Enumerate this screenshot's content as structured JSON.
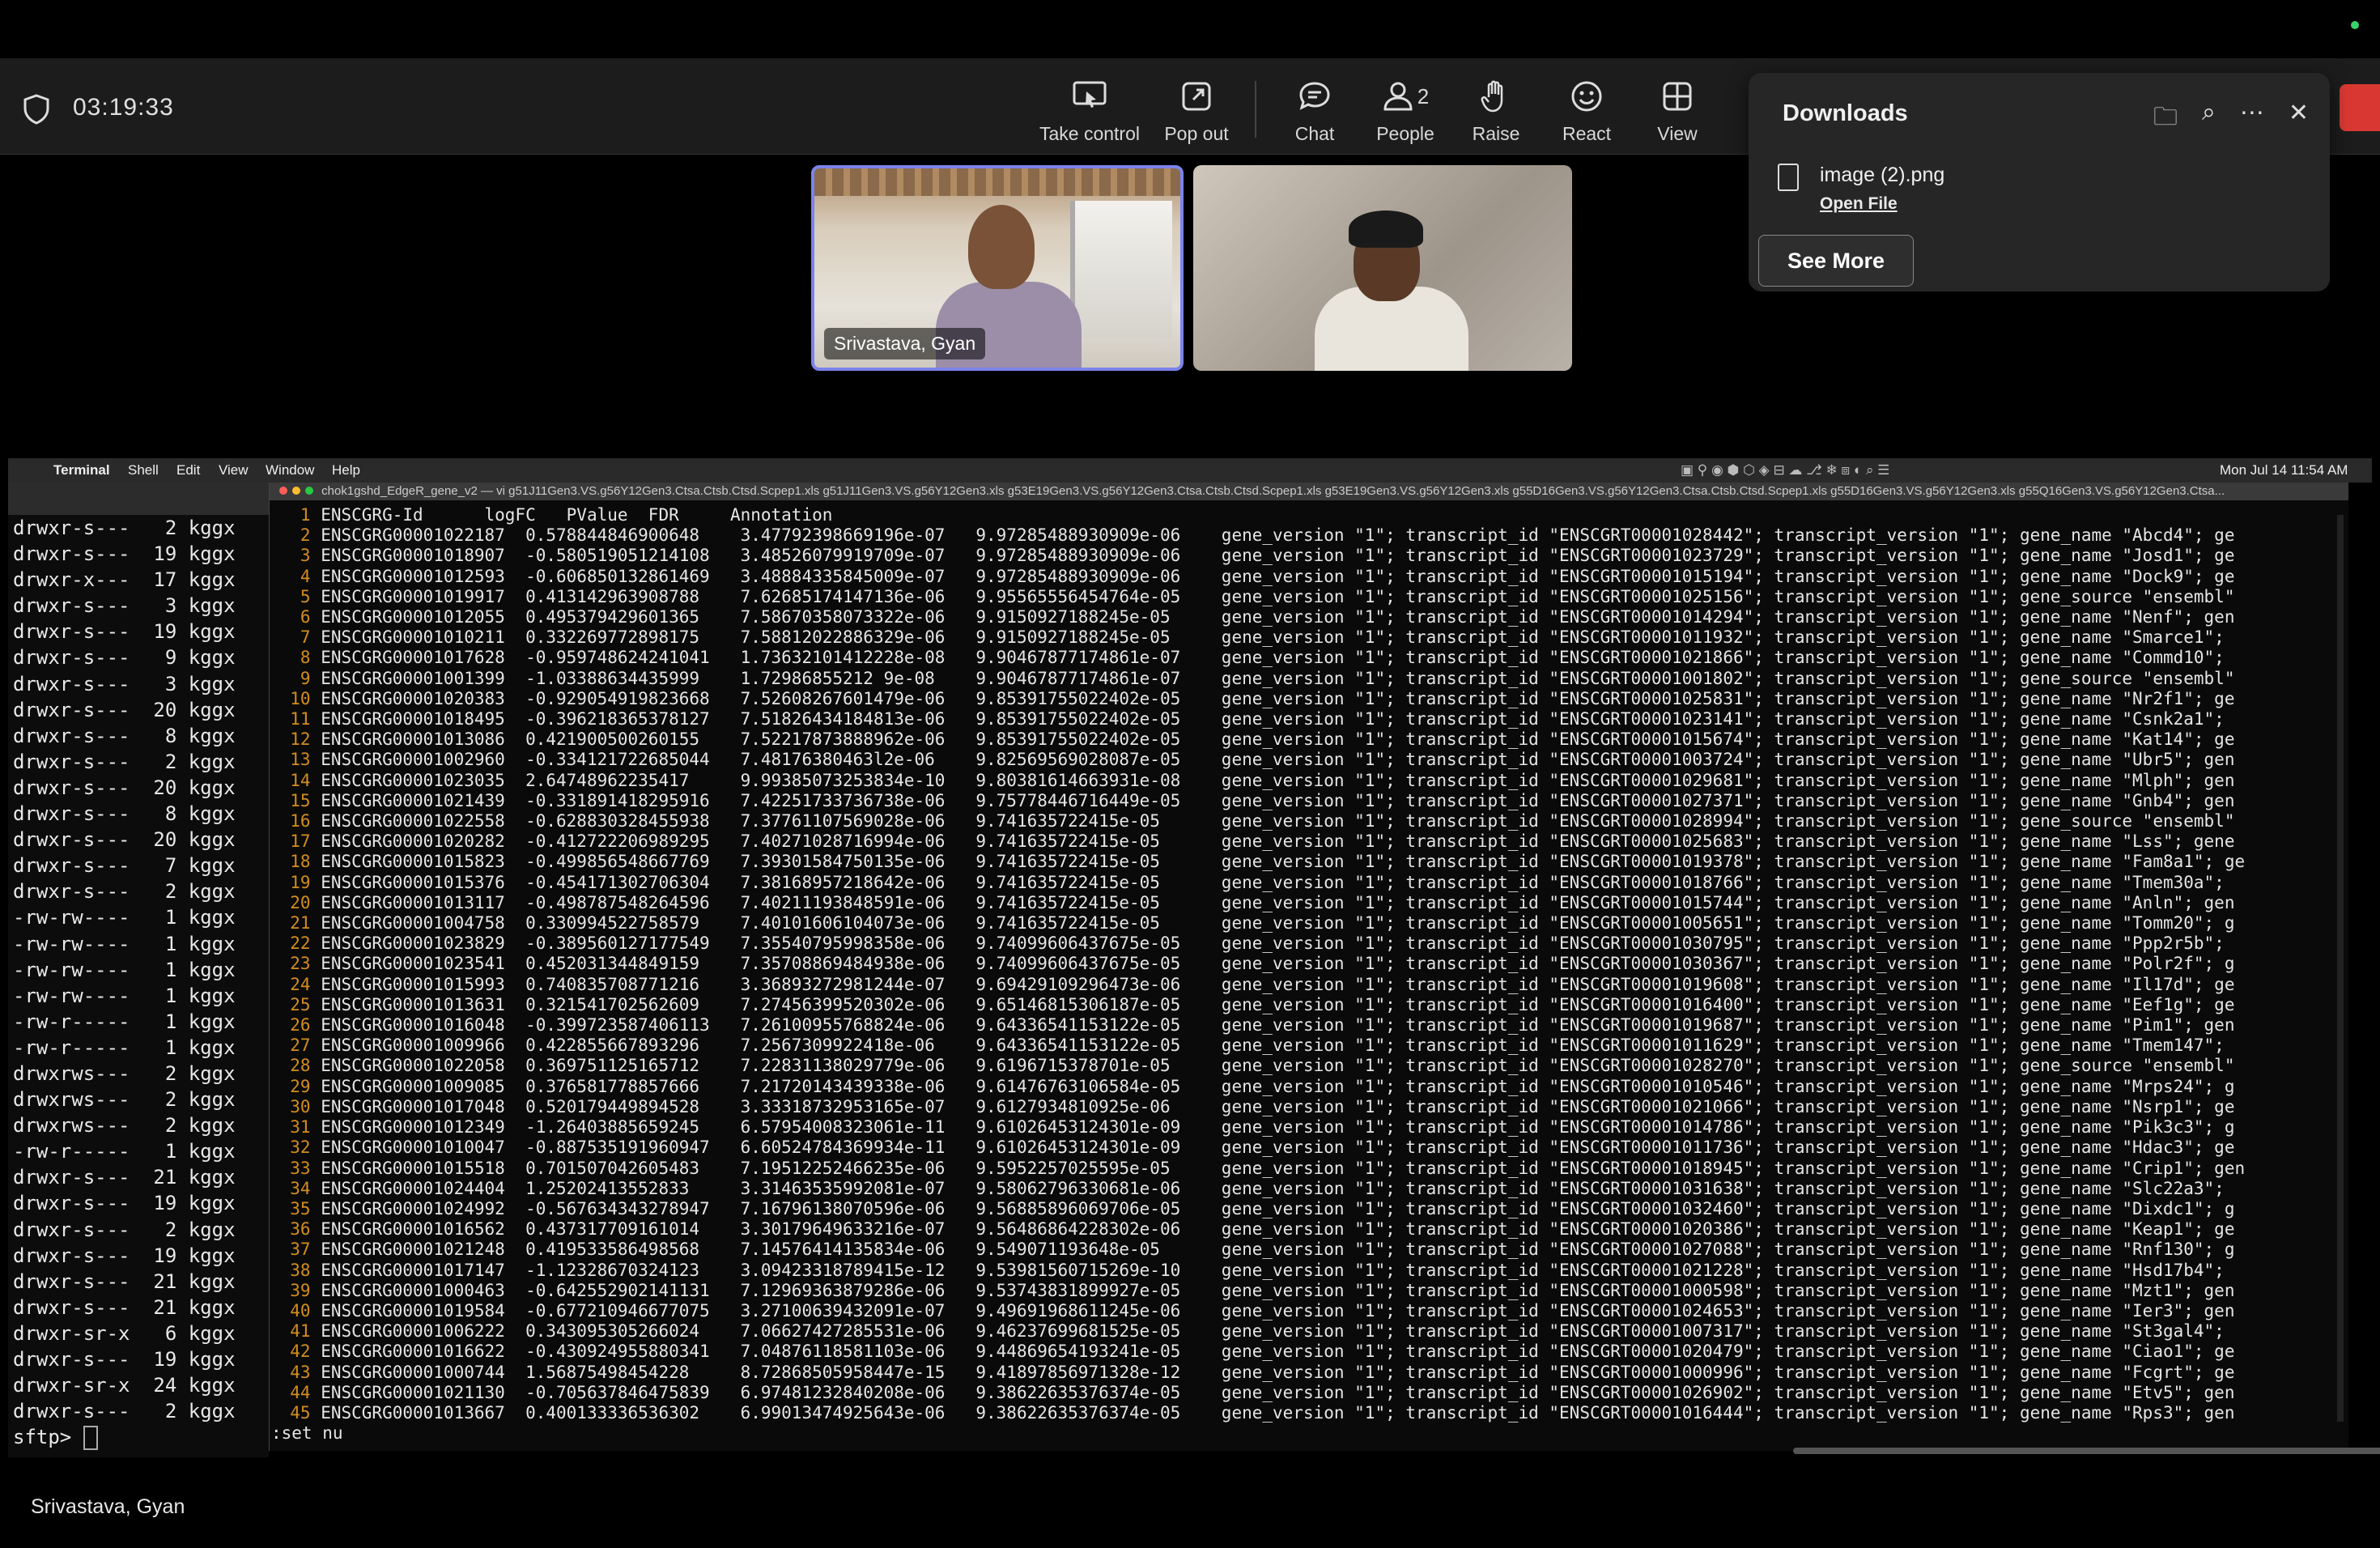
{
  "meeting": {
    "timer": "03:19:33",
    "toolbar": [
      {
        "label": "Take control",
        "icon": "take-control-icon"
      },
      {
        "label": "Pop out",
        "icon": "pop-out-icon"
      },
      {
        "label": "Chat",
        "icon": "chat-icon"
      },
      {
        "label": "People",
        "icon": "people-icon",
        "badge": "2"
      },
      {
        "label": "Raise",
        "icon": "raise-hand-icon"
      },
      {
        "label": "React",
        "icon": "react-icon"
      },
      {
        "label": "View",
        "icon": "view-icon"
      }
    ],
    "participants": [
      {
        "name": "Srivastava, Gyan"
      },
      {
        "name": ""
      }
    ],
    "presenter": "Srivastava, Gyan"
  },
  "downloads": {
    "title": "Downloads",
    "file_name": "image (2).png",
    "open_file": "Open File",
    "see_more": "See More"
  },
  "mac_menu": {
    "items": [
      "Terminal",
      "Shell",
      "Edit",
      "View",
      "Window",
      "Help"
    ],
    "clock": "Mon Jul 14  11:54 AM"
  },
  "left_terminal": {
    "lines": [
      "drwxr-s---   2 kggx",
      "drwxr-s---  19 kggx",
      "drwxr-x---  17 kggx",
      "drwxr-s---   3 kggx",
      "drwxr-s---  19 kggx",
      "drwxr-s---   9 kggx",
      "drwxr-s---   3 kggx",
      "drwxr-s---  20 kggx",
      "drwxr-s---   8 kggx",
      "drwxr-s---   2 kggx",
      "drwxr-s---  20 kggx",
      "drwxr-s---   8 kggx",
      "drwxr-s---  20 kggx",
      "drwxr-s---   7 kggx",
      "drwxr-s---   2 kggx",
      "-rw-rw----   1 kggx",
      "-rw-rw----   1 kggx",
      "-rw-rw----   1 kggx",
      "-rw-rw----   1 kggx",
      "-rw-r-----   1 kggx",
      "-rw-r-----   1 kggx",
      "drwxrws---   2 kggx",
      "drwxrws---   2 kggx",
      "drwxrws---   2 kggx",
      "-rw-r-----   1 kggx",
      "drwxr-s---  21 kggx",
      "drwxr-s---  19 kggx",
      "drwxr-s---   2 kggx",
      "drwxr-s---  19 kggx",
      "drwxr-s---  21 kggx",
      "drwxr-s---  21 kggx",
      "drwxr-sr-x   6 kggx",
      "drwxr-s---  19 kggx",
      "drwxr-sr-x  24 kggx",
      "drwxr-s---   2 kggx"
    ],
    "prompt": "sftp> "
  },
  "vim": {
    "title": "chok1gshd_EdgeR_gene_v2 — vi g51J11Gen3.VS.g56Y12Gen3.Ctsa.Ctsb.Ctsd.Scpep1.xls g51J11Gen3.VS.g56Y12Gen3.xls g53E19Gen3.VS.g56Y12Gen3.Ctsa.Ctsb.Ctsd.Scpep1.xls g53E19Gen3.VS.g56Y12Gen3.xls g55D16Gen3.VS.g56Y12Gen3.Ctsa.Ctsb.Ctsd.Scpep1.xls g55D16Gen3.VS.g56Y12Gen3.xls g55Q16Gen3.VS.g56Y12Gen3.Ctsa...",
    "header": "ENSCGRG-Id      logFC   PValue  FDR     Annotation",
    "rows": [
      [
        "ENSCGRG00001022187",
        "0.578844846900648",
        "3.47792398669196e-07",
        "9.97285488930909e-06",
        "gene_version \"1\"; transcript_id \"ENSCGRT00001028442\"; transcript_version \"1\"; gene_name \"Abcd4\"; ge"
      ],
      [
        "ENSCGRG00001018907",
        "-0.580519051214108",
        "3.48526079919709e-07",
        "9.97285488930909e-06",
        "gene_version \"1\"; transcript_id \"ENSCGRT00001023729\"; transcript_version \"1\"; gene_name \"Josd1\"; ge"
      ],
      [
        "ENSCGRG00001012593",
        "-0.606850132861469",
        "3.48884335845009e-07",
        "9.97285488930909e-06",
        "gene_version \"1\"; transcript_id \"ENSCGRT00001015194\"; transcript_version \"1\"; gene_name \"Dock9\"; ge"
      ],
      [
        "ENSCGRG00001019917",
        "0.413142963908788",
        "7.62685174147136e-06",
        "9.95565556454764e-05",
        "gene_version \"1\"; transcript_id \"ENSCGRT00001025156\"; transcript_version \"1\"; gene_source \"ensembl\""
      ],
      [
        "ENSCGRG00001012055",
        "0.495379429601365",
        "7.58670358073322e-06",
        "9.9150927188245e-05",
        "gene_version \"1\"; transcript_id \"ENSCGRT00001014294\"; transcript_version \"1\"; gene_name \"Nenf\"; gen"
      ],
      [
        "ENSCGRG00001010211",
        "0.332269772898175",
        "7.58812022886329e-06",
        "9.9150927188245e-05",
        "gene_version \"1\"; transcript_id \"ENSCGRT00001011932\"; transcript_version \"1\"; gene_name \"Smarce1\";"
      ],
      [
        "ENSCGRG00001017628",
        "-0.959748624241041",
        "1.73632101412228e-08",
        "9.90467877174861e-07",
        "gene_version \"1\"; transcript_id \"ENSCGRT00001021866\"; transcript_version \"1\"; gene_name \"Commd10\";"
      ],
      [
        "ENSCGRG00001001399",
        "-1.03388634435999",
        "1.72986855212 9e-08",
        "9.90467877174861e-07",
        "gene_version \"1\"; transcript_id \"ENSCGRT00001001802\"; transcript_version \"1\"; gene_source \"ensembl\""
      ],
      [
        "ENSCGRG00001020383",
        "-0.929054919823668",
        "7.52608267601479e-06",
        "9.85391755022402e-05",
        "gene_version \"1\"; transcript_id \"ENSCGRT00001025831\"; transcript_version \"1\"; gene_name \"Nr2f1\"; ge"
      ],
      [
        "ENSCGRG00001018495",
        "-0.396218365378127",
        "7.51826434184813e-06",
        "9.85391755022402e-05",
        "gene_version \"1\"; transcript_id \"ENSCGRT00001023141\"; transcript_version \"1\"; gene_name \"Csnk2a1\";"
      ],
      [
        "ENSCGRG00001013086",
        "0.421900500260155",
        "7.52217873888962e-06",
        "9.85391755022402e-05",
        "gene_version \"1\"; transcript_id \"ENSCGRT00001015674\"; transcript_version \"1\"; gene_name \"Kat14\"; ge"
      ],
      [
        "ENSCGRG00001002960",
        "-0.334121722685044",
        "7.48176380463l2e-06",
        "9.82569569028087e-05",
        "gene_version \"1\"; transcript_id \"ENSCGRT00001003724\"; transcript_version \"1\"; gene_name \"Ubr5\"; gen"
      ],
      [
        "ENSCGRG00001023035",
        "2.64748962235417",
        "9.99385073253834e-10",
        "9.80381614663931e-08",
        "gene_version \"1\"; transcript_id \"ENSCGRT00001029681\"; transcript_version \"1\"; gene_name \"Mlph\"; gen"
      ],
      [
        "ENSCGRG00001021439",
        "-0.331891418295916",
        "7.42251733736738e-06",
        "9.75778446716449e-05",
        "gene_version \"1\"; transcript_id \"ENSCGRT00001027371\"; transcript_version \"1\"; gene_name \"Gnb4\"; gen"
      ],
      [
        "ENSCGRG00001022558",
        "-0.628830328455938",
        "7.37761107569028e-06",
        "9.741635722415e-05",
        "gene_version \"1\"; transcript_id \"ENSCGRT00001028994\"; transcript_version \"1\"; gene_source \"ensembl\""
      ],
      [
        "ENSCGRG00001020282",
        "-0.412722206989295",
        "7.40271028716994e-06",
        "9.741635722415e-05",
        "gene_version \"1\"; transcript_id \"ENSCGRT00001025683\"; transcript_version \"1\"; gene_name \"Lss\"; gene"
      ],
      [
        "ENSCGRG00001015823",
        "-0.499856548667769",
        "7.39301584750135e-06",
        "9.741635722415e-05",
        "gene_version \"1\"; transcript_id \"ENSCGRT00001019378\"; transcript_version \"1\"; gene_name \"Fam8a1\"; ge"
      ],
      [
        "ENSCGRG00001015376",
        "-0.454171302706304",
        "7.38168957218642e-06",
        "9.741635722415e-05",
        "gene_version \"1\"; transcript_id \"ENSCGRT00001018766\"; transcript_version \"1\"; gene_name \"Tmem30a\";"
      ],
      [
        "ENSCGRG00001013117",
        "-0.498787548264596",
        "7.40211193848591e-06",
        "9.741635722415e-05",
        "gene_version \"1\"; transcript_id \"ENSCGRT00001015744\"; transcript_version \"1\"; gene_name \"Anln\"; gen"
      ],
      [
        "ENSCGRG00001004758",
        "0.330994522758579",
        "7.40101606104073e-06",
        "9.741635722415e-05",
        "gene_version \"1\"; transcript_id \"ENSCGRT00001005651\"; transcript_version \"1\"; gene_name \"Tomm20\"; g"
      ],
      [
        "ENSCGRG00001023829",
        "-0.389560127177549",
        "7.35540795998358e-06",
        "9.74099606437675e-05",
        "gene_version \"1\"; transcript_id \"ENSCGRT00001030795\"; transcript_version \"1\"; gene_name \"Ppp2r5b\";"
      ],
      [
        "ENSCGRG00001023541",
        "0.452031344849159",
        "7.35708869484938e-06",
        "9.74099606437675e-05",
        "gene_version \"1\"; transcript_id \"ENSCGRT00001030367\"; transcript_version \"1\"; gene_name \"Polr2f\"; g"
      ],
      [
        "ENSCGRG00001015993",
        "0.740835708771216",
        "3.36893272981244e-07",
        "9.69429109296473e-06",
        "gene_version \"1\"; transcript_id \"ENSCGRT00001019608\"; transcript_version \"1\"; gene_name \"Il17d\"; ge"
      ],
      [
        "ENSCGRG00001013631",
        "0.321541702562609",
        "7.27456399520302e-06",
        "9.65146815306187e-05",
        "gene_version \"1\"; transcript_id \"ENSCGRT00001016400\"; transcript_version \"1\"; gene_name \"Eef1g\"; ge"
      ],
      [
        "ENSCGRG00001016048",
        "-0.399723587406113",
        "7.26100955768824e-06",
        "9.64336541153122e-05",
        "gene_version \"1\"; transcript_id \"ENSCGRT00001019687\"; transcript_version \"1\"; gene_name \"Pim1\"; gen"
      ],
      [
        "ENSCGRG00001009966",
        "0.422855667893296",
        "7.2567309922418e-06",
        "9.64336541153122e-05",
        "gene_version \"1\"; transcript_id \"ENSCGRT00001011629\"; transcript_version \"1\"; gene_name \"Tmem147\";"
      ],
      [
        "ENSCGRG00001022058",
        "0.369751125165712",
        "7.22831138029779e-06",
        "9.6196715378701e-05",
        "gene_version \"1\"; transcript_id \"ENSCGRT00001028270\"; transcript_version \"1\"; gene_source \"ensembl\""
      ],
      [
        "ENSCGRG00001009085",
        "0.376581778857666",
        "7.21720143439338e-06",
        "9.61476763106584e-05",
        "gene_version \"1\"; transcript_id \"ENSCGRT00001010546\"; transcript_version \"1\"; gene_name \"Mrps24\"; g"
      ],
      [
        "ENSCGRG00001017048",
        "0.520179449894528",
        "3.33318732953165e-07",
        "9.6127934810925e-06",
        "gene_version \"1\"; transcript_id \"ENSCGRT00001021066\"; transcript_version \"1\"; gene_name \"Nsrp1\"; ge"
      ],
      [
        "ENSCGRG00001012349",
        "-1.26403885659245",
        "6.57954008323061e-11",
        "9.61026453124301e-09",
        "gene_version \"1\"; transcript_id \"ENSCGRT00001014786\"; transcript_version \"1\"; gene_name \"Pik3c3\"; g"
      ],
      [
        "ENSCGRG00001010047",
        "-0.887535191960947",
        "6.60524784369934e-11",
        "9.61026453124301e-09",
        "gene_version \"1\"; transcript_id \"ENSCGRT00001011736\"; transcript_version \"1\"; gene_name \"Hdac3\"; ge"
      ],
      [
        "ENSCGRG00001015518",
        "0.701507042605483",
        "7.19512252466235e-06",
        "9.5952257025595e-05",
        "gene_version \"1\"; transcript_id \"ENSCGRT00001018945\"; transcript_version \"1\"; gene_name \"Crip1\"; gen"
      ],
      [
        "ENSCGRG00001024404",
        "1.25202413552833",
        "3.31463535992081e-07",
        "9.58062796330681e-06",
        "gene_version \"1\"; transcript_id \"ENSCGRT00001031638\"; transcript_version \"1\"; gene_name \"Slc22a3\";"
      ],
      [
        "ENSCGRG00001024992",
        "-0.567634343278947",
        "7.16796138070596e-06",
        "9.56885896069706e-05",
        "gene_version \"1\"; transcript_id \"ENSCGRT00001032460\"; transcript_version \"1\"; gene_name \"Dixdc1\"; g"
      ],
      [
        "ENSCGRG00001016562",
        "0.437317709161014",
        "3.30179649633216e-07",
        "9.56486864228302e-06",
        "gene_version \"1\"; transcript_id \"ENSCGRT00001020386\"; transcript_version \"1\"; gene_name \"Keap1\"; ge"
      ],
      [
        "ENSCGRG00001021248",
        "0.419533586498568",
        "7.14576414135834e-06",
        "9.549071193648e-05",
        "gene_version \"1\"; transcript_id \"ENSCGRT00001027088\"; transcript_version \"1\"; gene_name \"Rnf130\"; g"
      ],
      [
        "ENSCGRG00001017147",
        "-1.12328670324123",
        "3.09423318789415e-12",
        "9.53981560715269e-10",
        "gene_version \"1\"; transcript_id \"ENSCGRT00001021228\"; transcript_version \"1\"; gene_name \"Hsd17b4\";"
      ],
      [
        "ENSCGRG00001000463",
        "-0.642552902141131",
        "7.12969363879286e-06",
        "9.53743831899927e-05",
        "gene_version \"1\"; transcript_id \"ENSCGRT00001000598\"; transcript_version \"1\"; gene_name \"Mzt1\"; gen"
      ],
      [
        "ENSCGRG00001019584",
        "-0.677210946677075",
        "3.27100639432091e-07",
        "9.49691968611245e-06",
        "gene_version \"1\"; transcript_id \"ENSCGRT00001024653\"; transcript_version \"1\"; gene_name \"Ier3\"; gen"
      ],
      [
        "ENSCGRG00001006222",
        "0.343095305266024",
        "7.06627427285531e-06",
        "9.46237699681525e-05",
        "gene_version \"1\"; transcript_id \"ENSCGRT00001007317\"; transcript_version \"1\"; gene_name \"St3gal4\";"
      ],
      [
        "ENSCGRG00001016622",
        "-0.430924955880341",
        "7.04876118581103e-06",
        "9.44869654193241e-05",
        "gene_version \"1\"; transcript_id \"ENSCGRT00001020479\"; transcript_version \"1\"; gene_name \"Ciao1\"; ge"
      ],
      [
        "ENSCGRG00001000744",
        "1.56875498454228",
        "8.72868505958447e-15",
        "9.41897856971328e-12",
        "gene_version \"1\"; transcript_id \"ENSCGRT00001000996\"; transcript_version \"1\"; gene_name \"Fcgrt\"; ge"
      ],
      [
        "ENSCGRG00001021130",
        "-0.705637846475839",
        "6.97481232840208e-06",
        "9.38622635376374e-05",
        "gene_version \"1\"; transcript_id \"ENSCGRT00001026902\"; transcript_version \"1\"; gene_name \"Etv5\"; gen"
      ],
      [
        "ENSCGRG00001013667",
        "0.400133336536302",
        "6.99013474925643e-06",
        "9.38622635376374e-05",
        "gene_version \"1\"; transcript_id \"ENSCGRT00001016444\"; transcript_version \"1\"; gene_name \"Rps3\"; gen"
      ]
    ],
    "command": ":set nu"
  }
}
